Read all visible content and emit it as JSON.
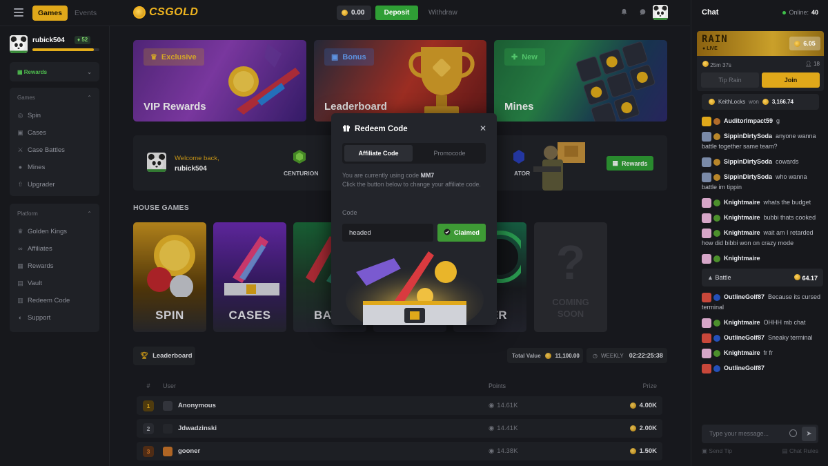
{
  "topbar": {
    "games_label": "Games",
    "events_label": "Events",
    "logo_text": "CSGOLD",
    "balance": "0.00",
    "deposit_label": "Deposit",
    "withdraw_label": "Withdraw",
    "icons": [
      "hamburger-icon",
      "bell-icon",
      "chat-bubble-icon"
    ]
  },
  "user": {
    "name": "rubick504",
    "level": "52",
    "xp_progress": 0.92
  },
  "sidebar": {
    "rewards_label": "Rewards",
    "games_header": "Games",
    "games": [
      {
        "label": "Spin",
        "icon": "spin-icon"
      },
      {
        "label": "Cases",
        "icon": "case-icon"
      },
      {
        "label": "Case Battles",
        "icon": "swords-icon"
      },
      {
        "label": "Mines",
        "icon": "bomb-icon"
      },
      {
        "label": "Upgrader",
        "icon": "arrow-up-icon"
      }
    ],
    "platform_header": "Platform",
    "platform": [
      {
        "label": "Golden Kings",
        "icon": "trophy-icon"
      },
      {
        "label": "Affiliates",
        "icon": "link-icon"
      },
      {
        "label": "Rewards",
        "icon": "gift-icon"
      },
      {
        "label": "Vault",
        "icon": "vault-icon"
      },
      {
        "label": "Redeem Code",
        "icon": "ticket-icon"
      },
      {
        "label": "Support",
        "icon": "headset-icon"
      }
    ]
  },
  "promos": [
    {
      "tag": "Exclusive",
      "title": "VIP Rewards"
    },
    {
      "tag": "Bonus",
      "title": "Leaderboard"
    },
    {
      "tag": "New",
      "title": "Mines"
    }
  ],
  "welcome": {
    "greeting": "Welcome back,",
    "username": "rubick504",
    "rank_left": "CENTURION",
    "rank_right": "ATOR",
    "rewards_button": "Rewards"
  },
  "house_games": {
    "title": "HOUSE GAMES",
    "cards": [
      "SPIN",
      "CASES",
      "BATT",
      "",
      "ADER",
      "COMING SOON"
    ]
  },
  "leaderboard": {
    "button_label": "Leaderboard",
    "total_value_label": "Total Value",
    "total_value": "11,100.00",
    "weekly_label": "WEEKLY",
    "timer": "02:22:25:38",
    "columns": {
      "rank": "#",
      "user": "User",
      "points": "Points",
      "prize": "Prize"
    },
    "rows": [
      {
        "rank": "1",
        "user": "Anonymous",
        "points": "14.61K",
        "prize": "4.00K"
      },
      {
        "rank": "2",
        "user": "Jdwadzinski",
        "points": "14.41K",
        "prize": "2.00K"
      },
      {
        "rank": "3",
        "user": "gooner",
        "points": "14.38K",
        "prize": "1.50K"
      }
    ]
  },
  "modal": {
    "title": "Redeem Code",
    "tab_affiliate": "Affiliate Code",
    "tab_promo": "Promocode",
    "text_prefix": "You are currently using code ",
    "current_code": "MM7",
    "text_suffix": "Click the button below to change your affiliate code.",
    "code_label": "Code",
    "code_value": "headed",
    "claimed_label": "Claimed"
  },
  "chat": {
    "title": "Chat",
    "online_label": "Online:",
    "online_count": "40",
    "rain": {
      "title": "RAIN",
      "live": "LIVE",
      "amount": "6.05",
      "timer": "25m 37s",
      "participants": "18",
      "tip_label": "Tip Rain",
      "join_label": "Join"
    },
    "won": {
      "user": "KeithLocks",
      "word": "won",
      "amount": "3,166.74"
    },
    "messages": [
      {
        "name": "AuditorImpact59",
        "text": "g",
        "av": "#e0a81a",
        "lv": "#b06b2a"
      },
      {
        "name": "SippinDirtySoda",
        "text": "anyone wanna battle together same team?",
        "av": "#7a8aa8",
        "lv": "#b8862a"
      },
      {
        "name": "SippinDirtySoda",
        "text": "cowards",
        "av": "#7a8aa8",
        "lv": "#b8862a"
      },
      {
        "name": "SippinDirtySoda",
        "text": "who wanna battle im tippin",
        "av": "#7a8aa8",
        "lv": "#b8862a"
      },
      {
        "name": "Knightmaire",
        "text": "whats the budget",
        "av": "#d6a6c8",
        "lv": "#4c8f2c"
      },
      {
        "name": "Knightmaire",
        "text": "bubbi thats cooked",
        "av": "#d6a6c8",
        "lv": "#4c8f2c"
      },
      {
        "name": "Knightmaire",
        "text": "wait am I retarded how did bibbi won on crazy mode",
        "av": "#d6a6c8",
        "lv": "#4c8f2c"
      },
      {
        "name": "Knightmaire",
        "text": "",
        "av": "#d6a6c8",
        "lv": "#4c8f2c"
      }
    ],
    "battle": {
      "label": "Battle",
      "amount": "64.17"
    },
    "messages2": [
      {
        "name": "OutlineGolf87",
        "text": "Because its cursed terminal",
        "av": "#c8473a",
        "lv": "#2450b8"
      },
      {
        "name": "Knightmaire",
        "text": "OHHH mb chat",
        "av": "#d6a6c8",
        "lv": "#4c8f2c"
      },
      {
        "name": "OutlineGolf87",
        "text": "Sneaky terminal",
        "av": "#c8473a",
        "lv": "#2450b8"
      },
      {
        "name": "Knightmaire",
        "text": "fr fr",
        "av": "#d6a6c8",
        "lv": "#4c8f2c"
      },
      {
        "name": "OutlineGolf87",
        "text": "",
        "av": "#c8473a",
        "lv": "#2450b8"
      }
    ],
    "input_placeholder": "Type your message...",
    "send_tip": "Send Tip",
    "chat_rules": "Chat Rules"
  },
  "colors": {
    "accent_gold": "#e0a81a",
    "accent_green": "#2f9e35",
    "bg": "#17181c"
  }
}
